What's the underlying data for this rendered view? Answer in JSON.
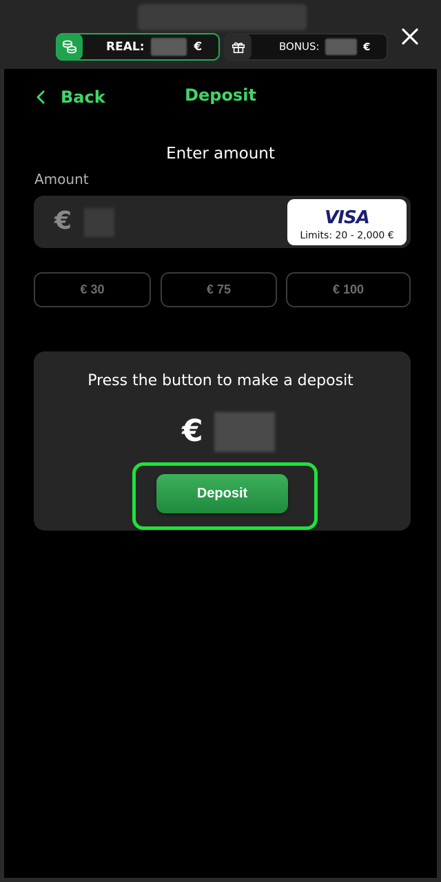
{
  "header": {
    "real_label": "REAL:",
    "real_currency": "€",
    "bonus_label": "BONUS:",
    "bonus_currency": "€",
    "close_icon": "close-icon"
  },
  "nav": {
    "back_label": "Back",
    "title": "Deposit"
  },
  "form": {
    "heading": "Enter amount",
    "amount_label": "Amount",
    "currency_symbol": "€",
    "payment_method": {
      "brand": "VISA",
      "limits": "Limits: 20 - 2,000 €"
    },
    "quick_amounts": [
      "€ 30",
      "€ 75",
      "€ 100"
    ]
  },
  "summary": {
    "instruction": "Press the button to make a deposit",
    "currency_symbol": "€",
    "deposit_button": "Deposit"
  },
  "colors": {
    "accent_green": "#3ed66b",
    "highlight_green": "#21e03e",
    "visa_blue": "#1a1f71"
  }
}
